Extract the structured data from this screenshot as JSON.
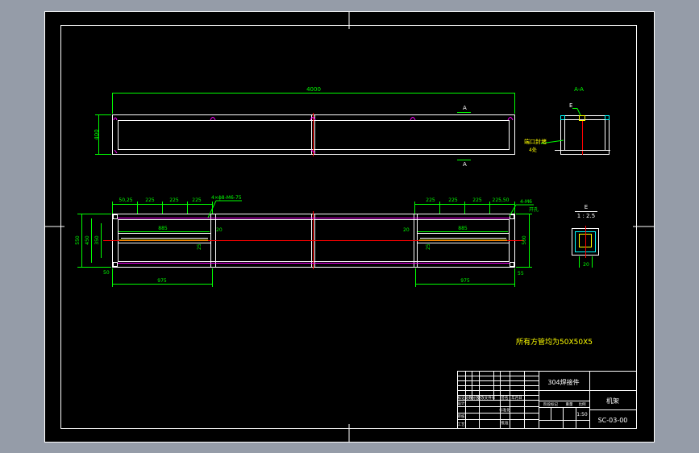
{
  "colors": {
    "viewport_bg": "#959ca8",
    "sheet": "#000000",
    "outline": "#ffffff",
    "dimension": "#00ff00",
    "centerline": "#ff0000",
    "joint": "#ff00ff",
    "weld_mark": "#ffff00",
    "side_detail": "#00ffff"
  },
  "front_view": {
    "overall_length": "4000",
    "height": "400",
    "section_mark_top": "A",
    "section_mark_bottom": "A"
  },
  "section_view": {
    "title": "A-A",
    "detail_ref": "E",
    "weld_note": "端口封堵",
    "weld_note_sub": "4处"
  },
  "plan_view": {
    "left_spacing": [
      "50,25",
      "225",
      "225",
      "225"
    ],
    "hole_note": "4×ϕ8-M6-75",
    "right_spacing": [
      "225",
      "225",
      "225",
      "225,50"
    ],
    "right_note": "4-M6",
    "right_note_sub": "开孔",
    "left_inner": "885",
    "right_inner": "885",
    "left_offset": "20",
    "right_offset": "20",
    "left_small": "25",
    "right_small": "25",
    "left_bottom": "975",
    "right_bottom": "975",
    "left_width_outer": "550",
    "left_width_mid": "450",
    "left_width_inner": "350",
    "right_width": "500",
    "left_foot": "50",
    "right_foot": "55"
  },
  "detail_view": {
    "title": "E",
    "scale": "1 : 2.5",
    "dim": "20"
  },
  "note": "所有方管均为50X50X5",
  "title_block": {
    "material": "304焊接件",
    "name": "机架",
    "drawing_no": "SC-03-00",
    "scale": "1:50",
    "row_labels": [
      "标记",
      "处数",
      "分区",
      "更改文件号",
      "签名",
      "年月日"
    ],
    "stage_labels": [
      "阶段标记",
      "重量",
      "比例"
    ],
    "left_labels": [
      "设计",
      "审核",
      "工艺"
    ],
    "right_labels": [
      "标准化",
      "批准"
    ]
  }
}
